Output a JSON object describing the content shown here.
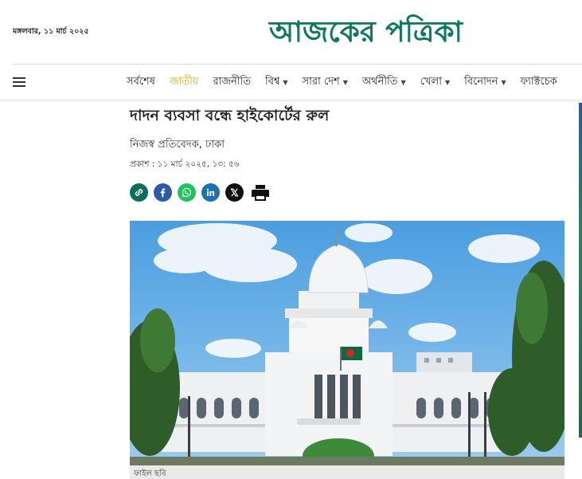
{
  "header": {
    "date": "মঙ্গলবার, ১১ মার্চ ২০২৫",
    "logo_text": "আজকের পত্রিকা"
  },
  "nav": {
    "items": [
      {
        "label": "সর্বশেষ",
        "has_dropdown": false,
        "active": false
      },
      {
        "label": "জাতীয়",
        "has_dropdown": false,
        "active": true
      },
      {
        "label": "রাজনীতি",
        "has_dropdown": false,
        "active": false
      },
      {
        "label": "বিশ্ব",
        "has_dropdown": true,
        "active": false
      },
      {
        "label": "সারা দেশ",
        "has_dropdown": true,
        "active": false
      },
      {
        "label": "অর্থনীতি",
        "has_dropdown": true,
        "active": false
      },
      {
        "label": "খেলা",
        "has_dropdown": true,
        "active": false
      },
      {
        "label": "বিনোদন",
        "has_dropdown": true,
        "active": false
      },
      {
        "label": "ফ্যাক্টচেক",
        "has_dropdown": false,
        "active": false
      }
    ],
    "active_color": "#e8a317"
  },
  "article": {
    "headline": "দাদন ব্যবসা বন্ধে হাইকোর্টের রুল",
    "byline": "নিজস্ব প্রতিবেদক, ঢাকা",
    "published": "প্রকাশ : ১১ মার্চ ২০২৫, ১৩: ৫৬",
    "share_icons": [
      "link-icon",
      "facebook-icon",
      "whatsapp-icon",
      "linkedin-icon",
      "x-icon",
      "print-icon"
    ],
    "photo_caption": "ফাইল ছবি"
  },
  "colors": {
    "brand": "#0b7a5f",
    "facebook": "#2a5ca8",
    "whatsapp": "#22c35e",
    "linkedin": "#1a72b0"
  }
}
